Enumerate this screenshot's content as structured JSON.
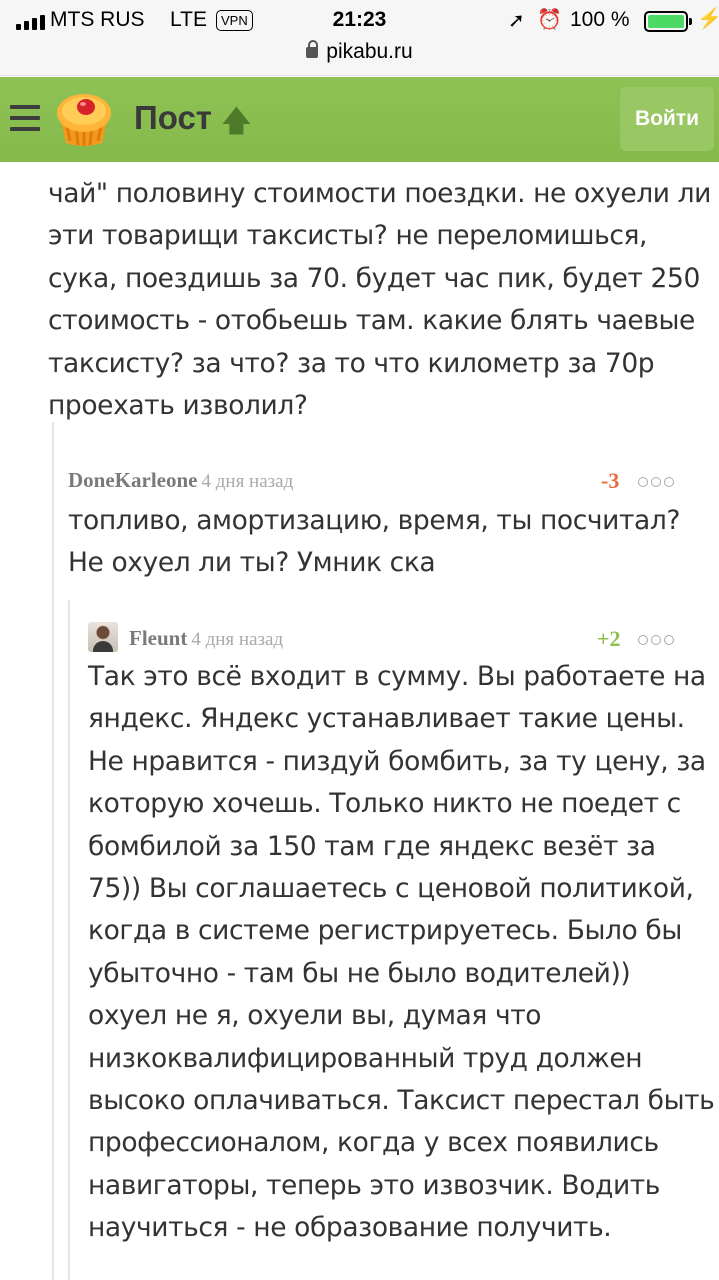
{
  "status_bar": {
    "carrier": "MTS RUS",
    "network": "LTE",
    "vpn": "VPN",
    "time": "21:23",
    "battery": "100 %",
    "url": "pikabu.ru",
    "icons": [
      "signal-icon",
      "location-icon",
      "alarm-icon",
      "battery-icon",
      "charging-icon",
      "lock-icon"
    ]
  },
  "header": {
    "title": "Пост",
    "login_label": "Войти",
    "colors": {
      "bar": "#8bc34a",
      "button": "#98c763"
    }
  },
  "comments": [
    {
      "author": "",
      "lines": [
        "чай\" половину стоимости поездки. не охуели ли",
        "эти товарищи таксисты? не переломишься,",
        "сука, поездишь за 70. будет час пик, будет 250",
        "стоимость - отобьешь там. какие блять чаевые",
        "таксисту? за что? за то что километр за 70р",
        "проехать изволил?"
      ]
    },
    {
      "author": "DoneKarleone",
      "time": "4 дня назад",
      "rating": "-3",
      "lines": [
        "топливо, амортизацию, время, ты посчитал?",
        "Не охуел ли ты? Умник ска"
      ]
    },
    {
      "author": "Fleunt",
      "time": "4 дня назад",
      "rating": "+2",
      "lines": [
        "Так это всё входит в сумму. Вы работаете на",
        "яндекс. Яндекс устанавливает такие цены.",
        "Не нравится - пиздуй бомбить, за ту цену, за",
        "которую хочешь. Только никто не поедет с",
        "бомбилой за 150 там где яндекс везёт за",
        "75)) Вы соглашаетесь с ценовой политикой,",
        "когда в системе регистрируетесь. Было бы",
        "убыточно - там бы не было водителей))",
        "охуел не я, охуели вы, думая что",
        "низкоквалифицированный труд должен",
        "высоко оплачиваться. Таксист перестал быть",
        "профессионалом, когда у всех появились",
        "навигаторы, теперь это извозчик. Водить",
        "научиться - не образование получить."
      ]
    }
  ]
}
